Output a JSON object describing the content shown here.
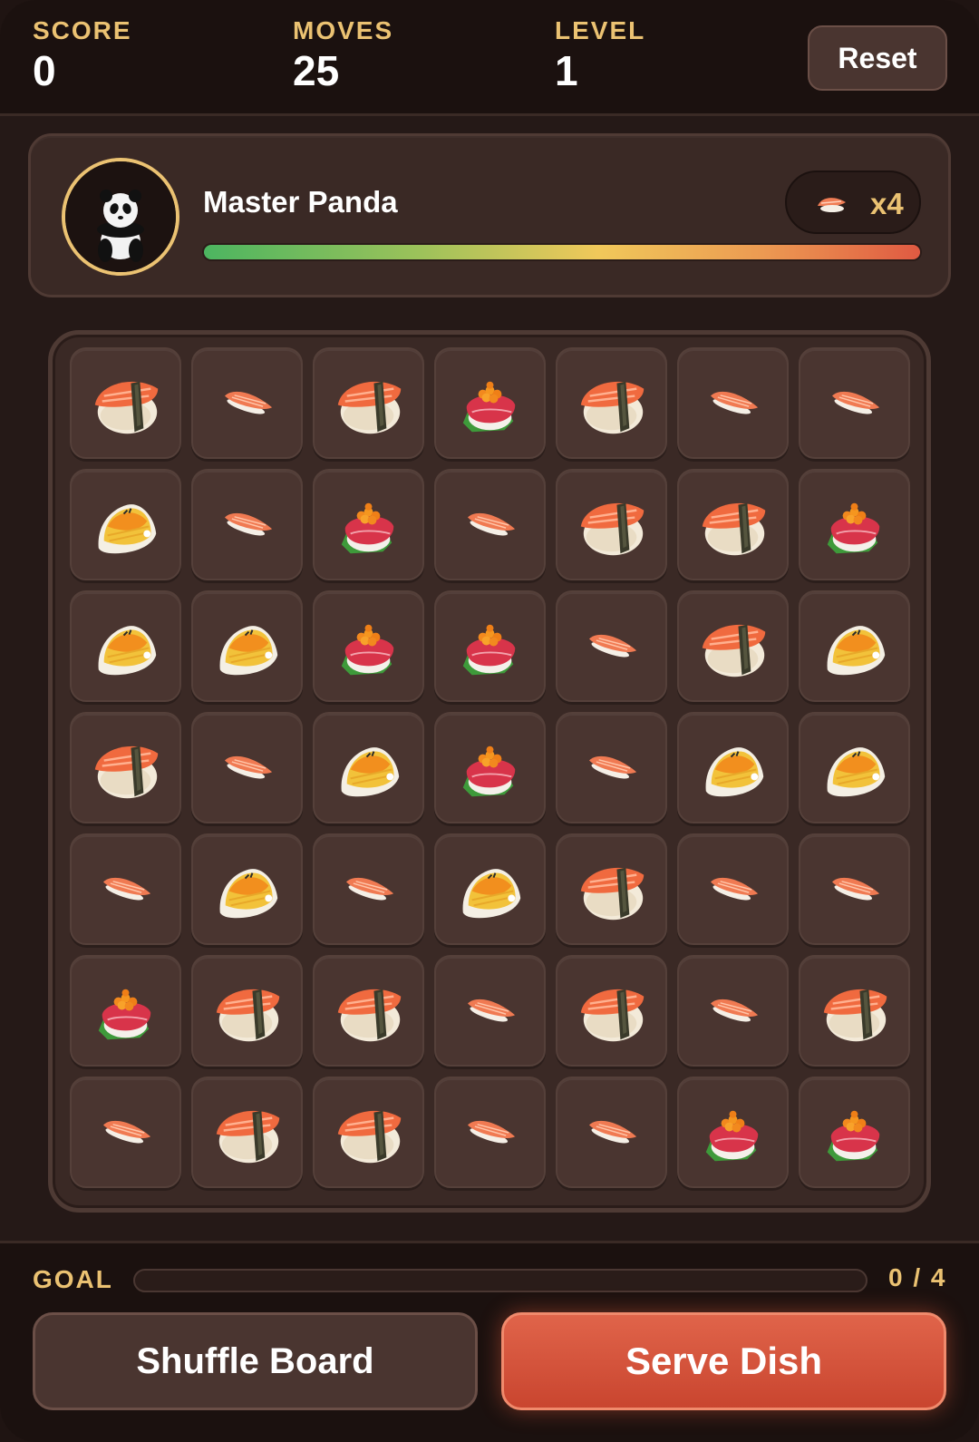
{
  "stats": {
    "score_label": "SCORE",
    "score": "0",
    "moves_label": "MOVES",
    "moves": "25",
    "level_label": "LEVEL",
    "level": "1"
  },
  "reset_label": "Reset",
  "chef": {
    "name": "Master Panda",
    "order_item_icon": "salmon-nigiri-icon",
    "order_count": "x4",
    "patience": 1.0
  },
  "board": {
    "rows": 7,
    "cols": 7,
    "tiles": [
      [
        "maki",
        "nigiri",
        "maki",
        "roe",
        "maki",
        "nigiri",
        "nigiri"
      ],
      [
        "tamago",
        "nigiri",
        "roe",
        "nigiri",
        "maki",
        "maki",
        "roe"
      ],
      [
        "tamago",
        "tamago",
        "roe",
        "roe",
        "nigiri",
        "maki",
        "tamago"
      ],
      [
        "maki",
        "nigiri",
        "tamago",
        "roe",
        "nigiri",
        "tamago",
        "tamago"
      ],
      [
        "nigiri",
        "tamago",
        "nigiri",
        "tamago",
        "maki",
        "nigiri",
        "nigiri"
      ],
      [
        "roe",
        "maki",
        "maki",
        "nigiri",
        "maki",
        "nigiri",
        "maki"
      ],
      [
        "nigiri",
        "maki",
        "maki",
        "nigiri",
        "nigiri",
        "roe",
        "roe"
      ]
    ]
  },
  "goal": {
    "label": "GOAL",
    "current": 0,
    "target": 4,
    "count_text": "0 / 4"
  },
  "actions": {
    "shuffle": "Shuffle Board",
    "serve": "Serve Dish"
  },
  "colors": {
    "accent": "#ebc272",
    "serve": "#d4543a",
    "bg": "#251917"
  }
}
